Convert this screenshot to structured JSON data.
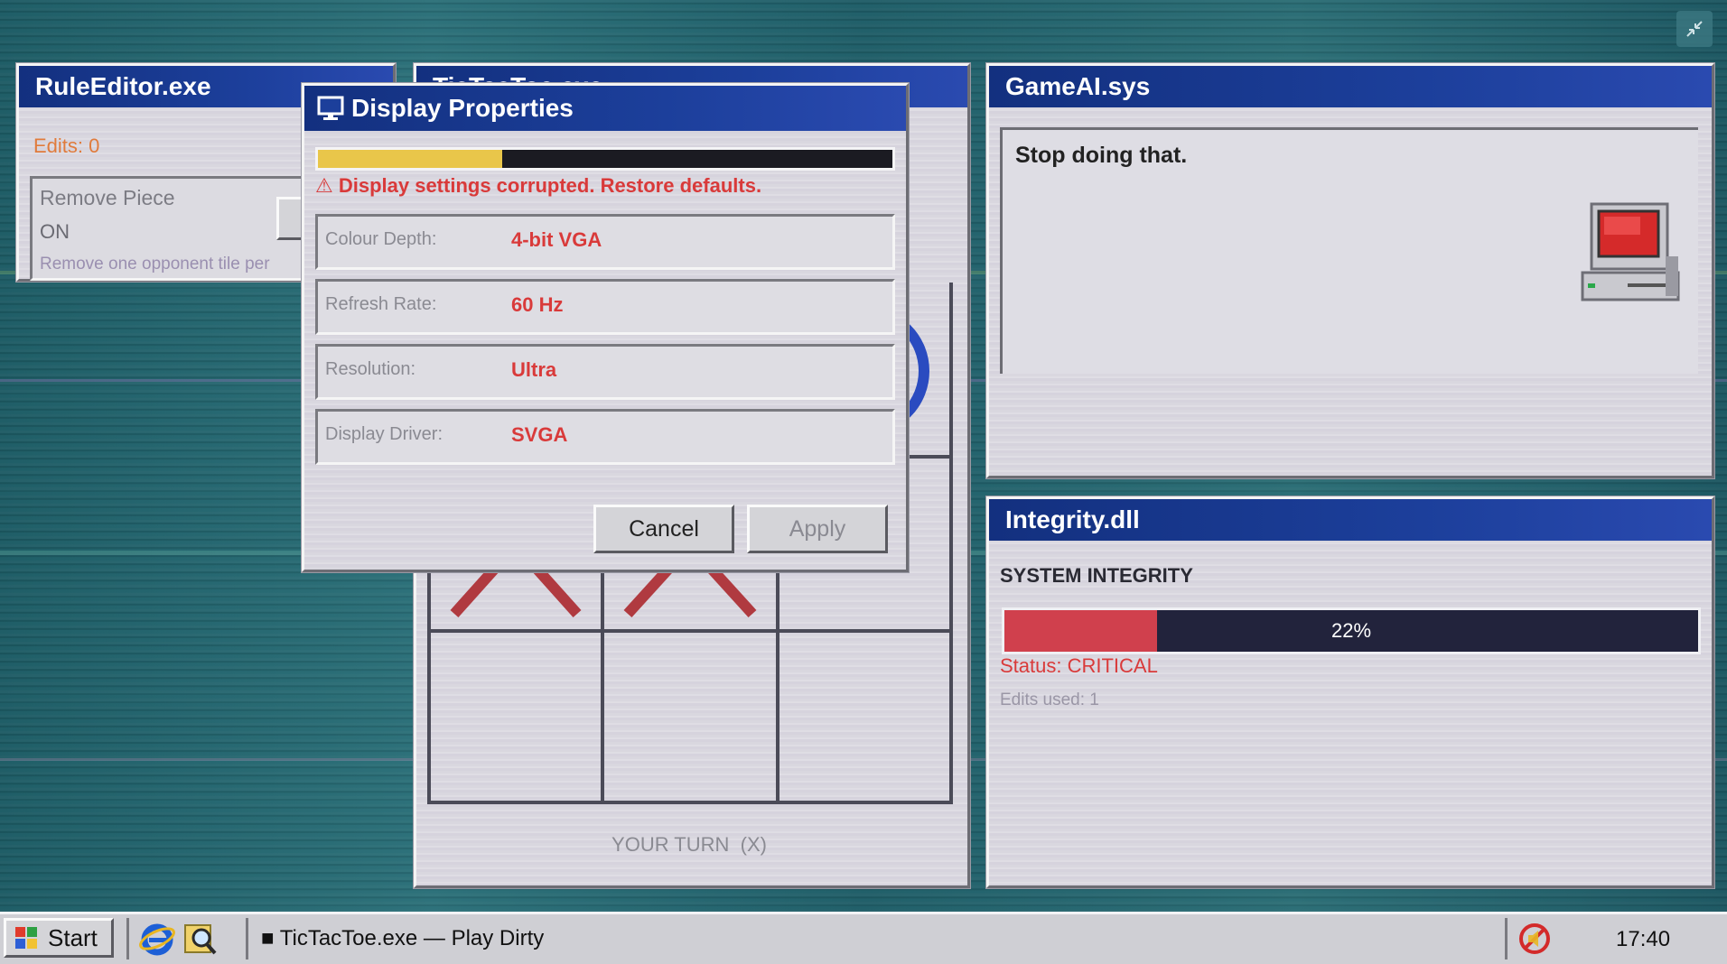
{
  "windows": {
    "rule_editor": {
      "title": "RuleEditor.exe",
      "edits_label": "Edits: 0",
      "rule_name": "Remove Piece",
      "rule_state": "ON",
      "rule_desc": "Remove one opponent tile per"
    },
    "tictactoe": {
      "title": "TicTacToe.exe",
      "turn_label": "YOUR TURN  (X)"
    },
    "game_ai": {
      "title": "GameAI.sys",
      "message": "Stop doing that."
    },
    "integrity": {
      "title": "Integrity.dll",
      "heading": "SYSTEM INTEGRITY",
      "percent_label": "22%",
      "percent_value": 0.22,
      "status": "Status: CRITICAL",
      "edits_used": "Edits used: 1"
    },
    "display_properties": {
      "title": "Display Properties",
      "progress_value": 0.32,
      "warning": "⚠ Display settings corrupted. Restore defaults.",
      "fields": [
        {
          "label": "Colour Depth:",
          "value": "4-bit VGA"
        },
        {
          "label": "Refresh Rate:",
          "value": "60 Hz"
        },
        {
          "label": "Resolution:",
          "value": "Ultra"
        },
        {
          "label": "Display Driver:",
          "value": "SVGA"
        }
      ],
      "cancel_label": "Cancel",
      "apply_label": "Apply"
    }
  },
  "taskbar": {
    "start_label": "Start",
    "task_label": "■ TicTacToe.exe — Play Dirty",
    "clock": "17:40"
  },
  "icons": [
    "windows-logo-icon",
    "ie-icon",
    "search-icon",
    "monitor-icon",
    "computer-icon",
    "no-sound-icon",
    "restore-icon"
  ],
  "colors": {
    "titlebar": "#1c3f9b",
    "accent_red": "#d93a3a",
    "progress_yellow": "#e9c64a",
    "integrity_red": "#d0404d",
    "x_mark": "#b03a40",
    "o_mark": "#2a4bc0"
  }
}
